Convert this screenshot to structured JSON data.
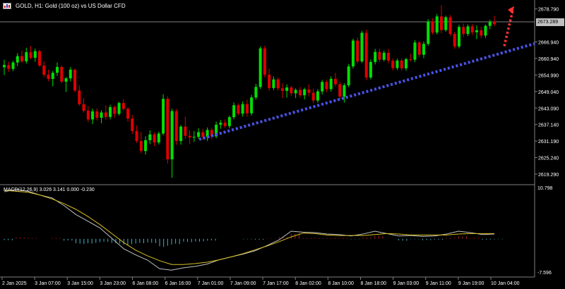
{
  "header": {
    "title": "GOLD, H1:  Gold (100 oz) vs US Dollar CFD"
  },
  "macd": {
    "label": "MACD(12,26,9) 3.026 3.141 0.000 -0.230",
    "axis_max": "10.798",
    "axis_min": "-7.596"
  },
  "price_axis": {
    "labels": [
      "2678.790",
      "2666.940",
      "2660.940",
      "2654.990",
      "2649.040",
      "2643.090",
      "2637.140",
      "2631.190",
      "2625.240",
      "2619.290"
    ],
    "current_price": "2673.289"
  },
  "time_axis": {
    "labels": [
      "2 Jan 2025",
      "3 Jan 07:00",
      "3 Jan 15:00",
      "3 Jan 23:00",
      "6 Jan 08:00",
      "6 Jan 16:00",
      "7 Jan 01:00",
      "7 Jan 09:00",
      "7 Jan 17:00",
      "8 Jan 02:00",
      "8 Jan 10:00",
      "8 Jan 18:00",
      "9 Jan 03:00",
      "9 Jan 11:00",
      "9 Jan 19:00",
      "10 Jan 04:00"
    ]
  },
  "colors": {
    "bull": "#00e000",
    "bear": "#e00000",
    "trendline": "#4a52e8",
    "arrow": "#ff3030",
    "macd_hist_pos": "#a01818",
    "macd_hist_neg": "#40b0c8",
    "macd_line": "#c0c0c0",
    "signal_line": "#d8c020"
  },
  "icons": {
    "window_icon": "chart-window-icon"
  },
  "chart_data": {
    "type": "candlestick",
    "symbol": "GOLD",
    "timeframe": "H1",
    "price_range": [
      2616.5,
      2681.0
    ],
    "candles": [
      [
        2657.8,
        2660.5,
        2655.0,
        2658.6
      ],
      [
        2658.6,
        2659.8,
        2656.1,
        2657.2
      ],
      [
        2657.2,
        2660.1,
        2656.4,
        2659.5
      ],
      [
        2659.5,
        2662.9,
        2658.2,
        2661.8
      ],
      [
        2661.8,
        2663.8,
        2659.3,
        2659.9
      ],
      [
        2659.9,
        2664.8,
        2659.1,
        2663.2
      ],
      [
        2663.2,
        2665.4,
        2660.7,
        2661.2
      ],
      [
        2661.2,
        2664.5,
        2659.8,
        2663.6
      ],
      [
        2663.6,
        2664.1,
        2658.0,
        2658.4
      ],
      [
        2658.4,
        2659.9,
        2654.2,
        2655.1
      ],
      [
        2655.1,
        2656.9,
        2652.8,
        2653.6
      ],
      [
        2653.6,
        2656.5,
        2650.9,
        2655.8
      ],
      [
        2655.8,
        2659.5,
        2654.6,
        2657.9
      ],
      [
        2657.9,
        2658.4,
        2652.0,
        2652.6
      ],
      [
        2652.6,
        2654.3,
        2648.9,
        2653.8
      ],
      [
        2653.8,
        2657.8,
        2652.7,
        2656.9
      ],
      [
        2656.9,
        2657.3,
        2648.8,
        2649.4
      ],
      [
        2649.4,
        2651.2,
        2643.9,
        2644.5
      ],
      [
        2644.5,
        2646.7,
        2641.5,
        2642.1
      ],
      [
        2642.1,
        2643.8,
        2638.1,
        2639.0
      ],
      [
        2639.0,
        2642.9,
        2637.3,
        2641.9
      ],
      [
        2641.9,
        2643.0,
        2638.6,
        2639.6
      ],
      [
        2639.6,
        2642.3,
        2637.6,
        2641.5
      ],
      [
        2641.5,
        2644.1,
        2638.9,
        2639.9
      ],
      [
        2639.9,
        2644.3,
        2639.0,
        2643.4
      ],
      [
        2643.4,
        2644.0,
        2639.6,
        2641.0
      ],
      [
        2641.0,
        2645.4,
        2640.4,
        2644.9
      ],
      [
        2644.9,
        2646.3,
        2642.0,
        2642.8
      ],
      [
        2642.8,
        2643.4,
        2638.2,
        2639.3
      ],
      [
        2639.3,
        2640.6,
        2633.8,
        2634.8
      ],
      [
        2634.8,
        2636.8,
        2630.5,
        2631.2
      ],
      [
        2631.2,
        2634.5,
        2626.7,
        2627.6
      ],
      [
        2627.6,
        2632.9,
        2626.3,
        2631.5
      ],
      [
        2631.5,
        2635.1,
        2630.1,
        2633.6
      ],
      [
        2633.6,
        2634.3,
        2629.4,
        2630.7
      ],
      [
        2630.7,
        2634.6,
        2630.0,
        2633.9
      ],
      [
        2633.9,
        2648.1,
        2633.3,
        2646.4
      ],
      [
        2646.4,
        2647.3,
        2623.1,
        2624.6
      ],
      [
        2624.6,
        2642.8,
        2618.0,
        2642.0
      ],
      [
        2642.0,
        2642.8,
        2629.8,
        2631.2
      ],
      [
        2631.2,
        2637.0,
        2629.9,
        2636.4
      ],
      [
        2636.4,
        2640.0,
        2632.0,
        2633.1
      ],
      [
        2633.1,
        2635.1,
        2630.2,
        2632.5
      ],
      [
        2632.5,
        2634.8,
        2630.9,
        2632.7
      ],
      [
        2632.7,
        2635.8,
        2632.0,
        2634.4
      ],
      [
        2634.4,
        2635.6,
        2631.7,
        2632.7
      ],
      [
        2632.7,
        2636.1,
        2631.2,
        2635.2
      ],
      [
        2635.2,
        2636.0,
        2631.9,
        2632.9
      ],
      [
        2632.9,
        2638.2,
        2632.2,
        2637.1
      ],
      [
        2637.1,
        2638.8,
        2635.6,
        2637.8
      ],
      [
        2637.8,
        2639.0,
        2635.9,
        2636.6
      ],
      [
        2636.6,
        2640.4,
        2635.8,
        2639.8
      ],
      [
        2639.8,
        2645.1,
        2639.0,
        2644.1
      ],
      [
        2644.1,
        2644.8,
        2640.5,
        2641.1
      ],
      [
        2641.1,
        2645.5,
        2640.0,
        2644.5
      ],
      [
        2644.5,
        2646.1,
        2640.0,
        2641.2
      ],
      [
        2641.2,
        2647.8,
        2640.4,
        2646.9
      ],
      [
        2646.9,
        2651.8,
        2646.1,
        2650.7
      ],
      [
        2650.7,
        2665.3,
        2650.0,
        2664.6
      ],
      [
        2664.6,
        2665.5,
        2654.2,
        2655.1
      ],
      [
        2655.1,
        2657.3,
        2649.4,
        2650.3
      ],
      [
        2650.3,
        2654.5,
        2649.5,
        2653.4
      ],
      [
        2653.4,
        2654.1,
        2649.4,
        2650.2
      ],
      [
        2650.2,
        2652.0,
        2646.8,
        2649.3
      ],
      [
        2649.3,
        2651.6,
        2646.9,
        2650.5
      ],
      [
        2650.5,
        2651.1,
        2647.5,
        2648.4
      ],
      [
        2648.4,
        2650.2,
        2646.7,
        2649.6
      ],
      [
        2649.6,
        2650.6,
        2646.9,
        2647.7
      ],
      [
        2647.7,
        2650.4,
        2646.2,
        2649.8
      ],
      [
        2649.8,
        2651.6,
        2647.3,
        2648.6
      ],
      [
        2648.6,
        2650.1,
        2644.9,
        2645.8
      ],
      [
        2645.8,
        2649.9,
        2645.0,
        2649.1
      ],
      [
        2649.1,
        2653.2,
        2648.0,
        2652.5
      ],
      [
        2652.5,
        2653.2,
        2648.8,
        2649.9
      ],
      [
        2649.9,
        2654.5,
        2649.0,
        2653.6
      ],
      [
        2653.6,
        2655.8,
        2650.8,
        2651.7
      ],
      [
        2651.7,
        2652.7,
        2646.4,
        2647.2
      ],
      [
        2647.2,
        2652.0,
        2645.1,
        2651.3
      ],
      [
        2651.3,
        2659.0,
        2650.6,
        2658.1
      ],
      [
        2658.1,
        2668.1,
        2657.3,
        2667.4
      ],
      [
        2667.4,
        2668.5,
        2659.2,
        2659.9
      ],
      [
        2659.9,
        2670.9,
        2659.3,
        2670.2
      ],
      [
        2670.2,
        2671.3,
        2653.1,
        2654.1
      ],
      [
        2654.1,
        2660.6,
        2653.4,
        2659.7
      ],
      [
        2659.7,
        2664.4,
        2658.8,
        2663.3
      ],
      [
        2663.3,
        2664.5,
        2659.7,
        2660.5
      ],
      [
        2660.5,
        2663.8,
        2659.9,
        2663.0
      ],
      [
        2663.0,
        2664.4,
        2659.2,
        2660.1
      ],
      [
        2660.1,
        2661.0,
        2656.6,
        2657.5
      ],
      [
        2657.5,
        2660.9,
        2656.8,
        2660.2
      ],
      [
        2660.2,
        2661.0,
        2656.5,
        2657.4
      ],
      [
        2657.4,
        2661.2,
        2656.6,
        2660.7
      ],
      [
        2660.7,
        2662.6,
        2659.8,
        2660.5
      ],
      [
        2660.5,
        2667.6,
        2659.6,
        2666.7
      ],
      [
        2666.7,
        2667.3,
        2661.4,
        2662.3
      ],
      [
        2662.3,
        2667.1,
        2661.1,
        2666.2
      ],
      [
        2666.2,
        2675.1,
        2665.5,
        2674.3
      ],
      [
        2674.3,
        2675.4,
        2669.6,
        2670.3
      ],
      [
        2670.3,
        2677.0,
        2669.6,
        2676.1
      ],
      [
        2676.1,
        2680.1,
        2670.0,
        2671.2
      ],
      [
        2671.2,
        2676.4,
        2670.6,
        2675.8
      ],
      [
        2675.8,
        2676.6,
        2669.1,
        2669.8
      ],
      [
        2669.8,
        2670.5,
        2664.4,
        2665.3
      ],
      [
        2665.3,
        2673.1,
        2664.6,
        2672.3
      ],
      [
        2672.3,
        2673.5,
        2668.7,
        2669.8
      ],
      [
        2669.8,
        2673.2,
        2669.0,
        2672.5
      ],
      [
        2672.5,
        2673.4,
        2669.4,
        2670.4
      ],
      [
        2670.4,
        2672.9,
        2667.9,
        2671.1
      ],
      [
        2671.1,
        2672.4,
        2668.2,
        2669.2
      ],
      [
        2669.2,
        2673.1,
        2668.4,
        2672.7
      ],
      [
        2672.7,
        2674.9,
        2671.5,
        2674.2
      ],
      [
        2674.2,
        2676.3,
        2672.6,
        2673.3
      ]
    ],
    "macd": {
      "range": [
        -7.596,
        10.798
      ],
      "line": [
        9.9,
        10.4,
        10.0,
        9.2,
        8.6,
        7.0,
        5.1,
        3.7,
        2.3,
        0.1,
        -2.1,
        -3.4,
        -4.5,
        -6.3,
        -6.6,
        -6.1,
        -5.8,
        -5.3,
        -4.4,
        -3.8,
        -3.2,
        -2.5,
        -1.4,
        -0.2,
        1.6,
        1.4,
        1.3,
        1.0,
        0.9,
        0.6,
        1.0,
        1.6,
        1.1,
        0.6,
        0.7,
        0.5,
        0.6,
        1.0,
        1.6,
        1.3,
        0.9,
        1.0
      ],
      "signal": [
        10.2,
        10.0,
        9.8,
        9.2,
        8.4,
        7.4,
        6.2,
        4.7,
        3.0,
        1.1,
        -0.8,
        -2.4,
        -3.6,
        -4.6,
        -5.4,
        -5.4,
        -5.2,
        -4.9,
        -4.4,
        -3.8,
        -3.1,
        -2.3,
        -1.5,
        -0.6,
        0.4,
        1.2,
        1.1,
        0.8,
        0.7,
        0.7,
        0.7,
        0.9,
        1.1,
        1.0,
        0.8,
        0.8,
        0.8,
        0.8,
        1.0,
        1.1,
        1.1,
        1.1
      ],
      "histogram": [
        -0.3,
        0.3,
        0.2,
        0.0,
        0.2,
        -0.4,
        -1.1,
        -1.0,
        -0.7,
        -1.0,
        -1.3,
        -1.0,
        -0.9,
        -1.7,
        -1.2,
        -0.7,
        -0.6,
        -0.4,
        0.0,
        0.0,
        -0.1,
        -0.2,
        0.1,
        0.4,
        1.2,
        0.2,
        0.2,
        0.2,
        0.2,
        -0.1,
        0.3,
        0.7,
        0.0,
        -0.4,
        -0.1,
        -0.3,
        -0.2,
        0.2,
        0.6,
        0.2,
        -0.2,
        -0.1
      ]
    }
  }
}
